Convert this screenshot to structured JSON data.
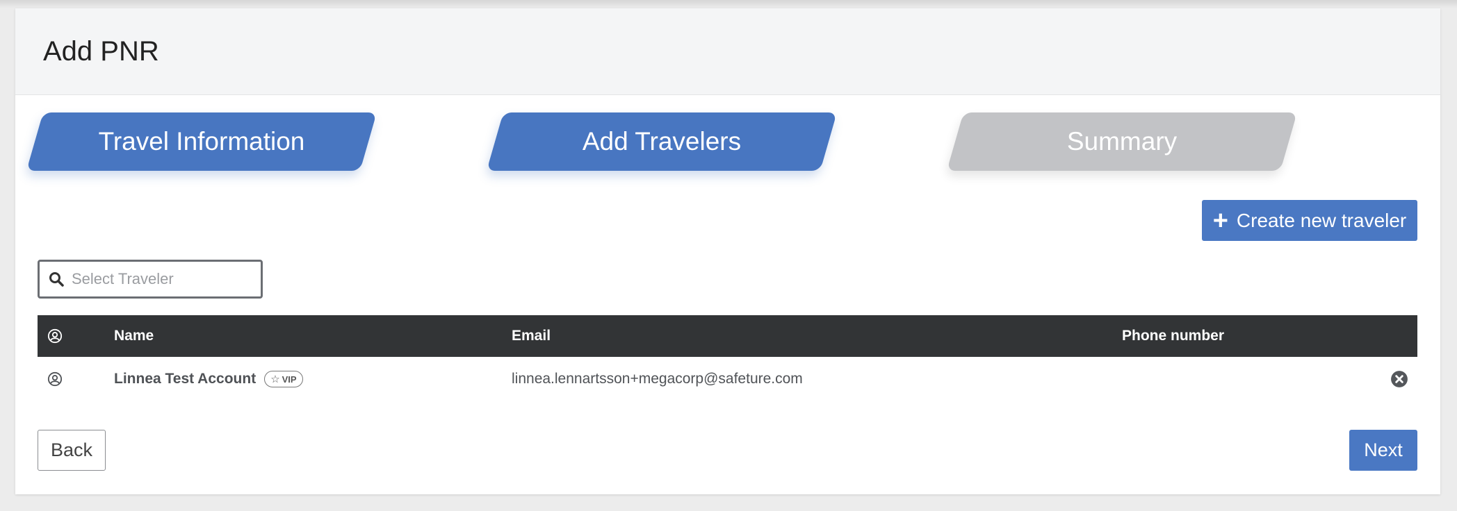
{
  "page": {
    "title": "Add PNR"
  },
  "steps": [
    {
      "label": "Travel Information",
      "state": "active"
    },
    {
      "label": "Add Travelers",
      "state": "active"
    },
    {
      "label": "Summary",
      "state": "inactive"
    }
  ],
  "actions": {
    "create_label": "Create new traveler",
    "back_label": "Back",
    "next_label": "Next"
  },
  "search": {
    "placeholder": "Select Traveler",
    "value": ""
  },
  "table": {
    "columns": {
      "name": "Name",
      "email": "Email",
      "phone": "Phone number"
    },
    "rows": [
      {
        "name": "Linnea Test Account",
        "badge": "VIP",
        "email": "linnea.lennartsson+megacorp@safeture.com",
        "phone": ""
      }
    ]
  },
  "colors": {
    "accent": "#4876c1",
    "inactive_step": "#c2c3c6",
    "table_header": "#323436"
  },
  "icons": {
    "search": "search-icon",
    "plus": "plus-icon",
    "user": "user-circle-icon",
    "star": "star-icon",
    "remove": "close-circle-icon"
  }
}
